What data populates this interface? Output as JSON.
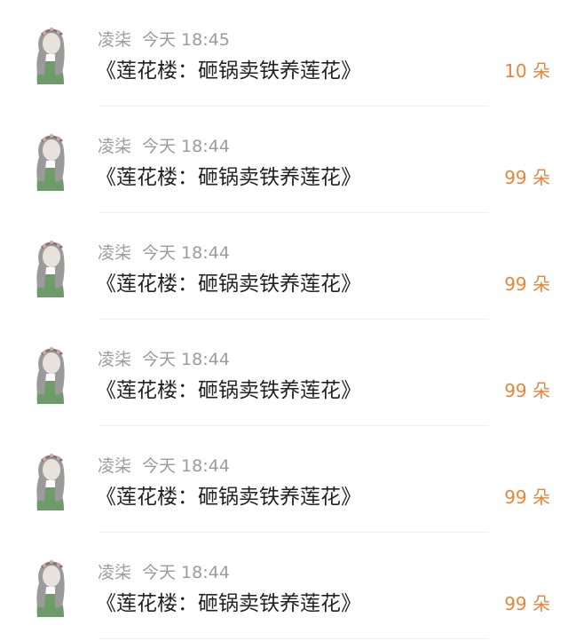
{
  "accent_color": "#e8853a",
  "avatar_icon": "girl-with-flower-crown-avatar",
  "gifts": [
    {
      "name": "凌柒",
      "time": "今天 18:45",
      "title": "《莲花楼：砸锅卖铁养莲花》",
      "amount": "10 朵"
    },
    {
      "name": "凌柒",
      "time": "今天 18:44",
      "title": "《莲花楼：砸锅卖铁养莲花》",
      "amount": "99 朵"
    },
    {
      "name": "凌柒",
      "time": "今天 18:44",
      "title": "《莲花楼：砸锅卖铁养莲花》",
      "amount": "99 朵"
    },
    {
      "name": "凌柒",
      "time": "今天 18:44",
      "title": "《莲花楼：砸锅卖铁养莲花》",
      "amount": "99 朵"
    },
    {
      "name": "凌柒",
      "time": "今天 18:44",
      "title": "《莲花楼：砸锅卖铁养莲花》",
      "amount": "99 朵"
    },
    {
      "name": "凌柒",
      "time": "今天 18:44",
      "title": "《莲花楼：砸锅卖铁养莲花》",
      "amount": "99 朵"
    }
  ]
}
